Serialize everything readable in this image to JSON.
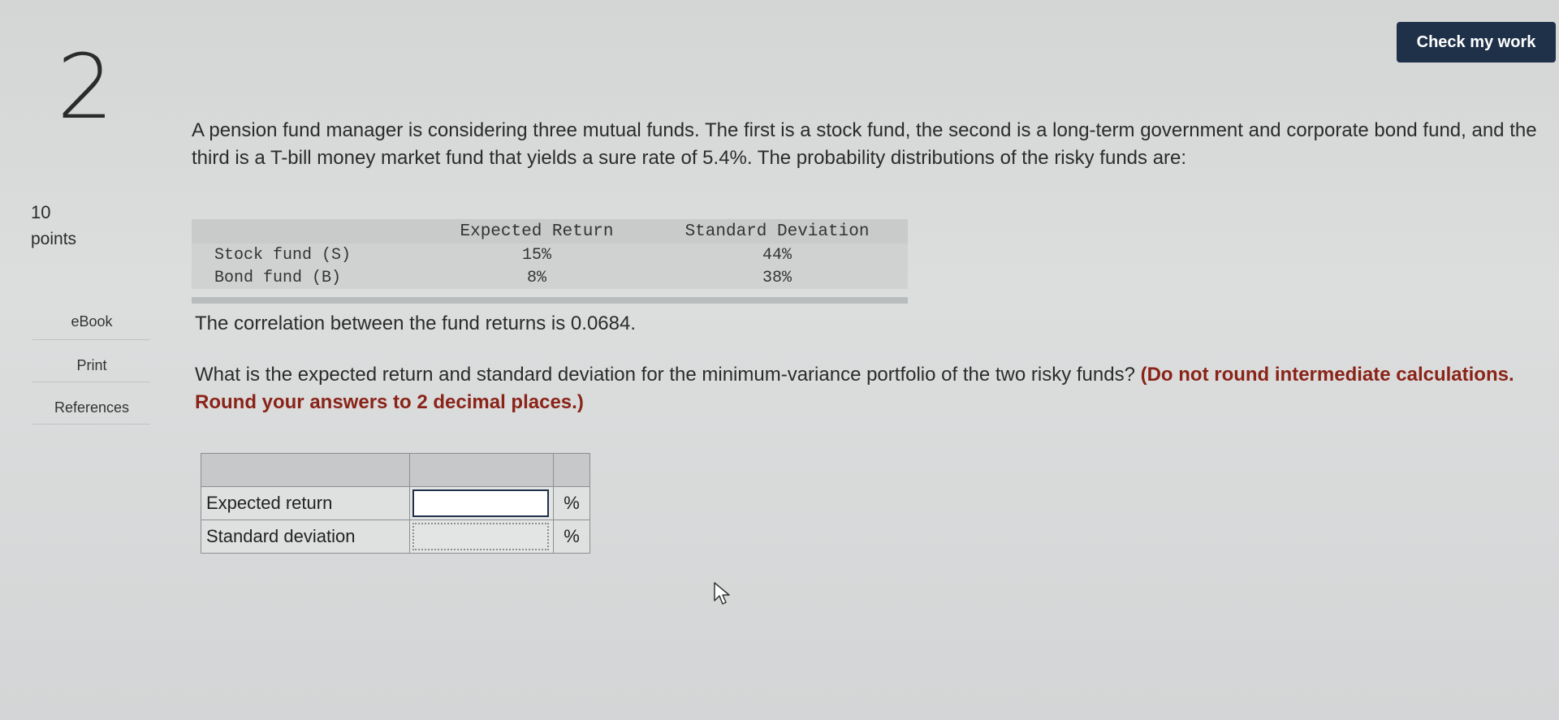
{
  "question": {
    "number": "2",
    "points_value": "10",
    "points_label": "points"
  },
  "sidebar": {
    "items": [
      {
        "label": "eBook"
      },
      {
        "label": "Print"
      },
      {
        "label": "References"
      }
    ]
  },
  "header": {
    "check_button_label": "Check my work"
  },
  "problem": {
    "prompt": "A pension fund manager is considering three mutual funds. The first is a stock fund, the second is a long-term government and corporate bond fund, and the third is a T-bill money market fund that yields a sure rate of 5.4%. The probability distributions of the risky funds are:",
    "table": {
      "headers": [
        "",
        "Expected Return",
        "Standard Deviation"
      ],
      "rows": [
        {
          "name": "Stock fund (S)",
          "expected_return": "15%",
          "std_dev": "44%"
        },
        {
          "name": "Bond fund (B)",
          "expected_return": "8%",
          "std_dev": "38%"
        }
      ]
    },
    "correlation": "The correlation between the fund returns is 0.0684.",
    "question_text": "What is the expected return and standard deviation for the minimum-variance portfolio of the two risky funds?",
    "instruction": "(Do not round intermediate calculations. Round your answers to 2 decimal places.)"
  },
  "answer_table": {
    "rows": [
      {
        "label": "Expected return",
        "value": "",
        "unit": "%"
      },
      {
        "label": "Standard deviation",
        "value": "",
        "unit": "%"
      }
    ]
  },
  "colors": {
    "button_bg": "#1f3149",
    "instruction_text": "#8a2318"
  },
  "icons": {
    "cursor": "mouse-pointer-icon"
  }
}
